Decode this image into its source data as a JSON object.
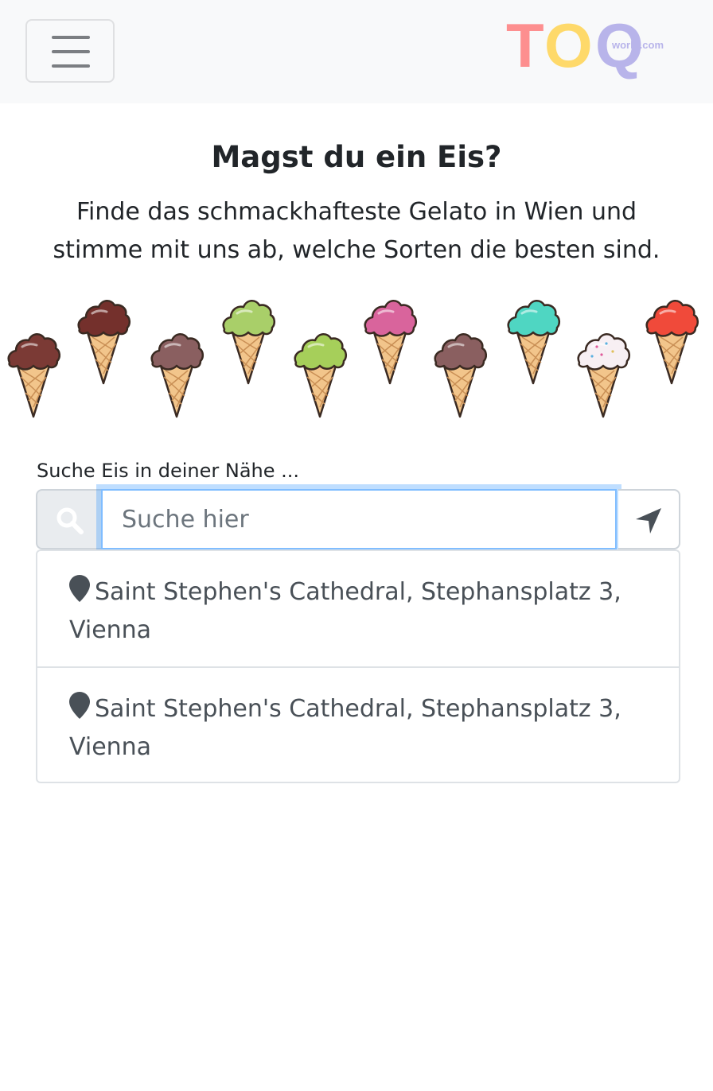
{
  "navbar": {
    "toggle_icon": "hamburger-icon",
    "brand": {
      "big": "TOQ",
      "small": "world.com",
      "colors": [
        "#fd8f8f",
        "#fed96a",
        "#b8b4ea"
      ]
    }
  },
  "hero": {
    "title": "Magst du ein Eis?",
    "lead": "Finde das schmackhafteste Gelato in Wien und stimme mit uns ab, welche Sorten die besten sind."
  },
  "ice_creams": [
    {
      "flavor_color": "#7b3a35"
    },
    {
      "flavor_color": "#74302c"
    },
    {
      "flavor_color": "#8a5f60"
    },
    {
      "flavor_color": "#a9cf69"
    },
    {
      "flavor_color": "#a6cf5a"
    },
    {
      "flavor_color": "#d9649c"
    },
    {
      "flavor_color": "#8a5f60"
    },
    {
      "flavor_color": "#4fd6c2"
    },
    {
      "flavor_color": "#f7eff3"
    },
    {
      "flavor_color": "#f04a3a"
    }
  ],
  "search": {
    "label": "Suche Eis in deiner Nähe ...",
    "placeholder": "Suche hier",
    "value": "",
    "left_icon": "search-icon",
    "right_icon": "location-arrow-icon"
  },
  "results": [
    {
      "icon": "map-marker-icon",
      "text": "Saint Stephen's Cathedral, Stephansplatz 3, Vienna"
    },
    {
      "icon": "map-marker-icon",
      "text": "Saint Stephen's Cathedral, Stephansplatz 3, Vienna"
    }
  ],
  "colors": {
    "focus_border": "#80bdff",
    "navbar_bg": "#f8f9fa",
    "icon_gray": "#495057"
  }
}
